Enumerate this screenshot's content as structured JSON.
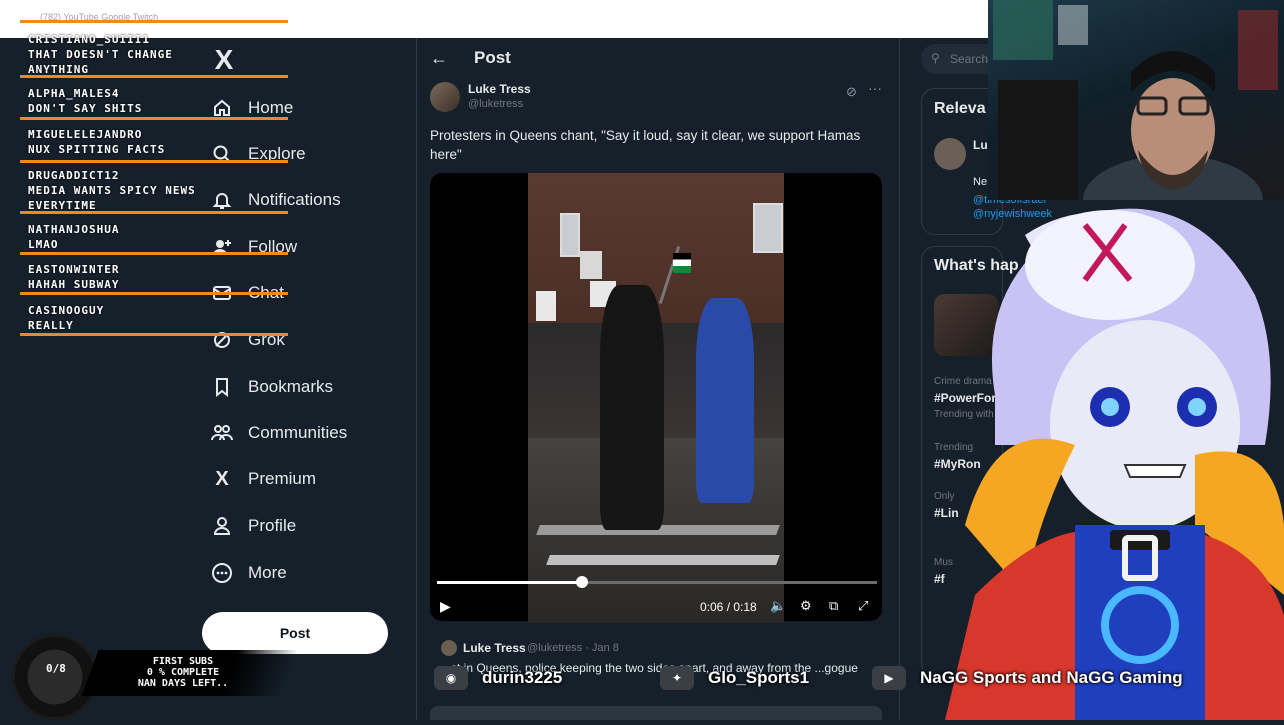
{
  "browser": {
    "bookmarks": "(782) YouTube   Google   Twitch"
  },
  "chat": [
    {
      "user": "cristiano_suiii1",
      "message": "that doesn't change anything"
    },
    {
      "user": "alpha_males4",
      "message": "don't say shits"
    },
    {
      "user": "miguelelejandro",
      "message": "nux spitting facts"
    },
    {
      "user": "drugaddict12",
      "message": "media wants spicy news everytime"
    },
    {
      "user": "nathanjoshua",
      "message": "lmao"
    },
    {
      "user": "eastonwinter",
      "message": "hahah subway"
    },
    {
      "user": "casinooguy",
      "message": "really"
    }
  ],
  "sidebar": {
    "logo": "X",
    "items": [
      {
        "label": "Home",
        "icon": "home-icon"
      },
      {
        "label": "Explore",
        "icon": "search-icon"
      },
      {
        "label": "Notifications",
        "icon": "bell-icon"
      },
      {
        "label": "Follow",
        "icon": "follow-icon"
      },
      {
        "label": "Chat",
        "icon": "mail-icon"
      },
      {
        "label": "Grok",
        "icon": "grok-icon"
      },
      {
        "label": "Bookmarks",
        "icon": "bookmark-icon"
      },
      {
        "label": "Communities",
        "icon": "communities-icon"
      },
      {
        "label": "Premium",
        "icon": "x-premium-icon"
      },
      {
        "label": "Profile",
        "icon": "profile-icon"
      },
      {
        "label": "More",
        "icon": "more-icon"
      }
    ],
    "post_button": "Post"
  },
  "post": {
    "header": "Post",
    "author_name": "Luke Tress",
    "author_handle": "@luketress",
    "text": "Protesters in Queens chant, \"Say it loud, say it clear, we support Hamas here\"",
    "video": {
      "time": "0:06 / 0:18",
      "progress": 0.33
    }
  },
  "reply": {
    "author_name": "Luke Tress",
    "author_handle": "@luketress · Jan 8",
    "text": "...st in Queens, police keeping the two sides apart, and away from the ...gogue"
  },
  "right": {
    "search_placeholder": "Search",
    "relevant_title": "Releva",
    "relevant_name": "Lu",
    "relevant_line": "Ne",
    "relevant_link1": "@timesofisrael",
    "relevant_link2": "@nyjewishweek",
    "whats_title": "What's hap",
    "trends": [
      {
        "meta": "Crime drama · Tren",
        "tag": "#PowerForce",
        "with": "Trending with Tariq"
      },
      {
        "meta": "Trending",
        "tag": "#MyRon",
        "with": ""
      },
      {
        "meta": "Only",
        "tag": "#Lin",
        "with": ""
      },
      {
        "meta": "Mus",
        "tag": "#f",
        "with": ""
      }
    ]
  },
  "overlay": {
    "subs_count": "0/8",
    "subs_text": "first subs\n0 % complete\nNaN days left..",
    "socials": [
      {
        "icon": "discord-icon",
        "label": "durin3225"
      },
      {
        "icon": "twitter-icon",
        "label": "Glo_Sports1"
      },
      {
        "icon": "youtube-icon",
        "label": "NaGG Sports and NaGG Gaming"
      }
    ]
  }
}
